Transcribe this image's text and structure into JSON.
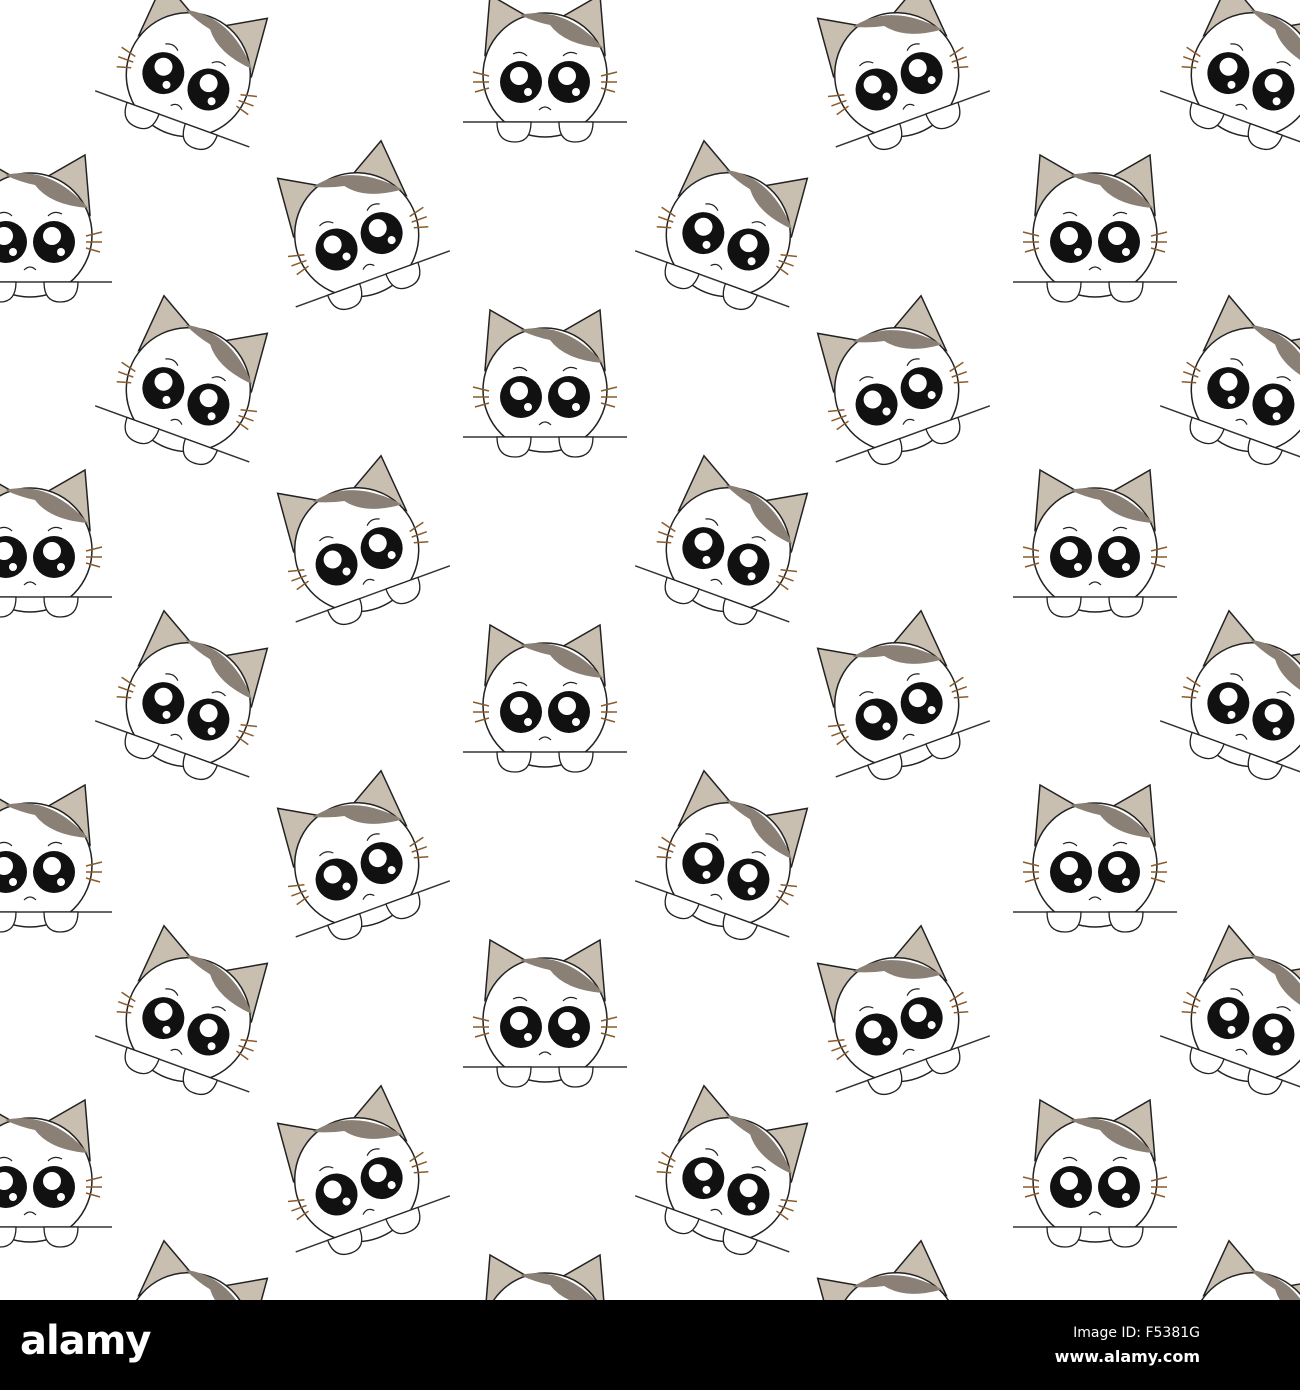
{
  "watermark": {
    "logo": "alamy",
    "image_id": "Image ID: F5381G",
    "website": "www.alamy.com"
  },
  "colors": {
    "ear": "#c9bfb1",
    "patch": "#8a8075",
    "outline": "#222222",
    "whisker": "#8a5a2b",
    "background": "#ffffff",
    "bar": "#000000"
  }
}
